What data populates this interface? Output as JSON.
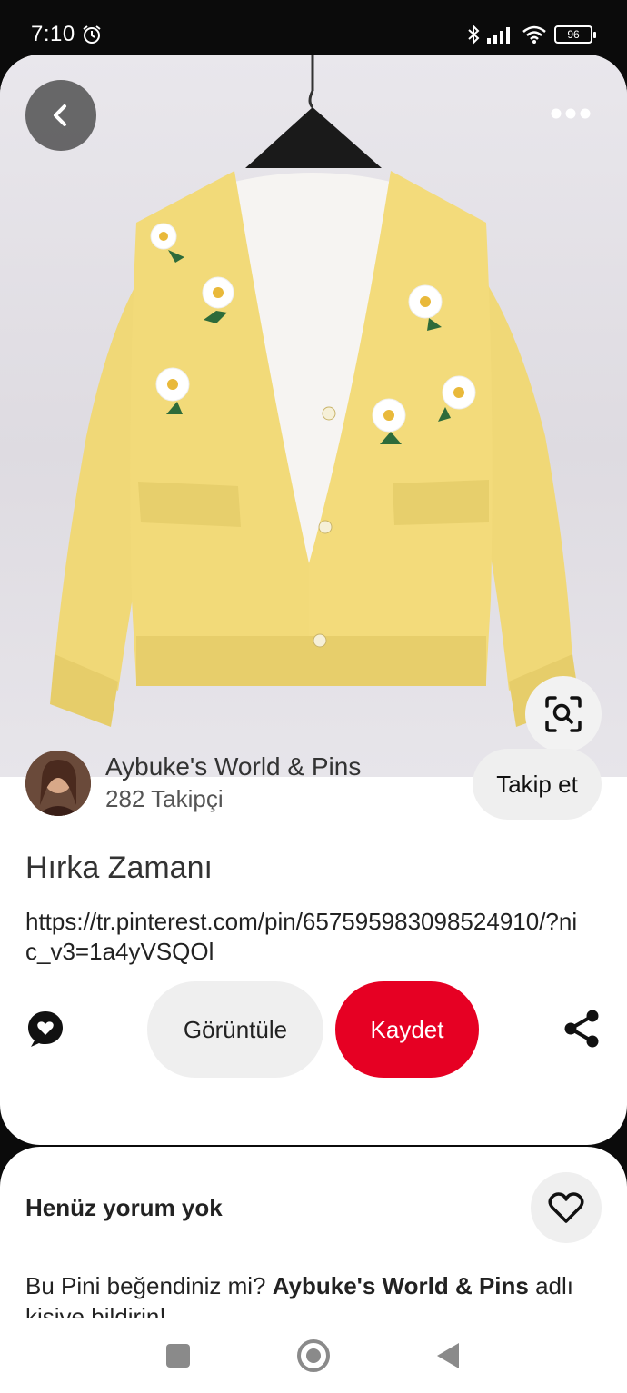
{
  "status_bar": {
    "time": "7:10",
    "battery": "96"
  },
  "pin": {
    "creator_name": "Aybuke's World & Pins",
    "creator_followers": "282 Takipçi",
    "follow_label": "Takip et",
    "title": "Hırka Zamanı",
    "link": "https://tr.pinterest.com/pin/657595983098524910/?nic_v3=1a4yVSQOl",
    "view_label": "Görüntüle",
    "save_label": "Kaydet"
  },
  "comments": {
    "title": "Henüz yorum yok",
    "prompt_prefix": "Bu Pini beğendiniz mi? ",
    "prompt_creator": "Aybuke's World & Pins",
    "prompt_suffix": " adlı kişiye bildirin!"
  },
  "icons": [
    "alarm-icon",
    "bluetooth-icon",
    "signal-icon",
    "wifi-icon",
    "battery-icon",
    "back-arrow-icon",
    "more-icon",
    "lens-search-icon",
    "comment-icon",
    "share-icon",
    "heart-icon"
  ],
  "colors": {
    "save_red": "#e60023",
    "cardigan_yellow": "#f2db7a"
  }
}
